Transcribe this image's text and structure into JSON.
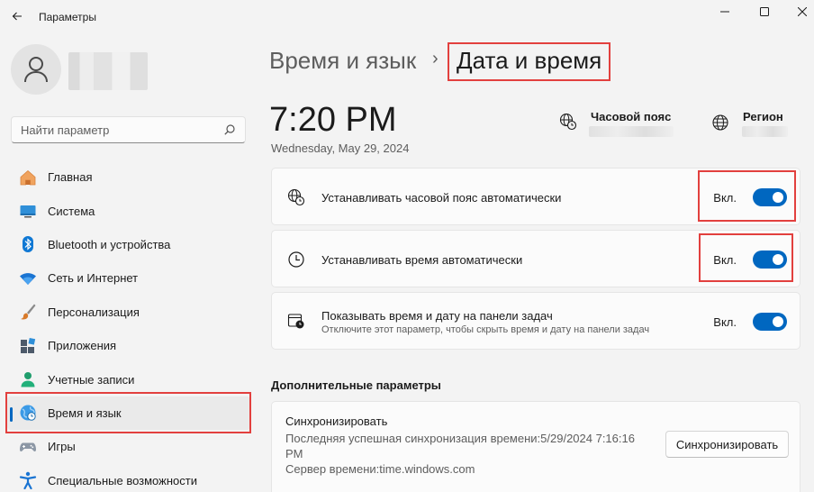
{
  "window": {
    "title": "Параметры"
  },
  "search": {
    "placeholder": "Найти параметр"
  },
  "sidebar": {
    "items": [
      {
        "label": "Главная",
        "icon": "home-icon"
      },
      {
        "label": "Система",
        "icon": "system-icon"
      },
      {
        "label": "Bluetooth и устройства",
        "icon": "bluetooth-icon"
      },
      {
        "label": "Сеть и Интернет",
        "icon": "wifi-icon"
      },
      {
        "label": "Персонализация",
        "icon": "brush-icon"
      },
      {
        "label": "Приложения",
        "icon": "apps-icon"
      },
      {
        "label": "Учетные записи",
        "icon": "account-icon"
      },
      {
        "label": "Время и язык",
        "icon": "time-language-icon",
        "active": true
      },
      {
        "label": "Игры",
        "icon": "gamepad-icon"
      },
      {
        "label": "Специальные возможности",
        "icon": "accessibility-icon"
      }
    ]
  },
  "header": {
    "parent": "Время и язык",
    "separator": "›",
    "current": "Дата и время"
  },
  "clock": {
    "time": "7:20 PM",
    "date": "Wednesday, May 29, 2024"
  },
  "meta": {
    "timezone_title": "Часовой пояс",
    "region_title": "Регион"
  },
  "settings": [
    {
      "label": "Устанавливать часовой пояс автоматически",
      "state": "Вкл.",
      "on": true,
      "icon": "globe-clock-icon"
    },
    {
      "label": "Устанавливать время автоматически",
      "state": "Вкл.",
      "on": true,
      "icon": "clock-icon"
    },
    {
      "label": "Показывать время и дату на панели задач",
      "sublabel": "Отключите этот параметр, чтобы скрыть время и дату на панели задач",
      "state": "Вкл.",
      "on": true,
      "icon": "calendar-clock-icon"
    }
  ],
  "additional": {
    "title": "Дополнительные параметры",
    "sync_title": "Синхронизировать",
    "last_sync_line1": "Последняя успешная синхронизация времени:5/29/2024 7:16:16",
    "last_sync_line2": "PM",
    "server": "Сервер времени:time.windows.com",
    "sync_button": "Синхронизировать"
  },
  "colors": {
    "accent": "#0067c0",
    "highlight": "#e2403e",
    "background": "#f3f3f3"
  }
}
